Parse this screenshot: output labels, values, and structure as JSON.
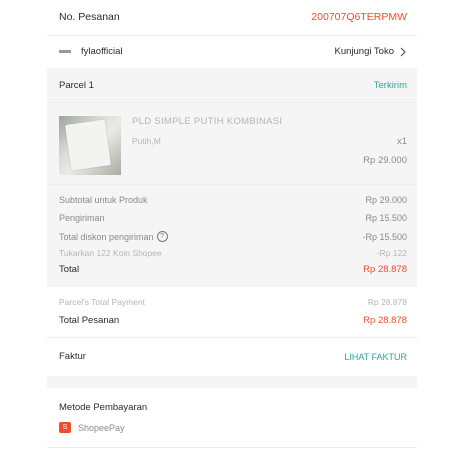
{
  "order": {
    "label": "No. Pesanan",
    "number": "200707Q6TERPMW"
  },
  "shop": {
    "name": "fylaofficial",
    "visit_label": "Kunjungi Toko"
  },
  "parcel": {
    "label": "Parcel 1",
    "status": "Terkirim"
  },
  "product": {
    "name": "PLD SIMPLE PUTIH KOMBINASI",
    "variant": "Putih,M",
    "qty": "x1",
    "price": "Rp 29.000"
  },
  "summary": [
    {
      "label": "Subtotal untuk Produk",
      "value": "Rp 29.000"
    },
    {
      "label": "Pengiriman",
      "value": "Rp 15.500"
    },
    {
      "label": "Total diskon pengiriman",
      "value": "-Rp 15.500"
    },
    {
      "label": "Tukarkan 122 Koin Shopee",
      "value": "-Rp 122"
    }
  ],
  "total": {
    "label": "Total",
    "value": "Rp 28.878"
  },
  "parcel_total": {
    "label": "Parcel's Total Payment",
    "value": "Rp 28.878"
  },
  "order_total": {
    "label": "Total Pesanan",
    "value": "Rp 28.878"
  },
  "invoice": {
    "label": "Faktur",
    "link": "LIHAT FAKTUR"
  },
  "payment": {
    "title": "Metode Pembayaran",
    "method": "ShopeePay"
  },
  "colors": {
    "accent": "#ee4d2d",
    "teal": "#26aa99"
  }
}
